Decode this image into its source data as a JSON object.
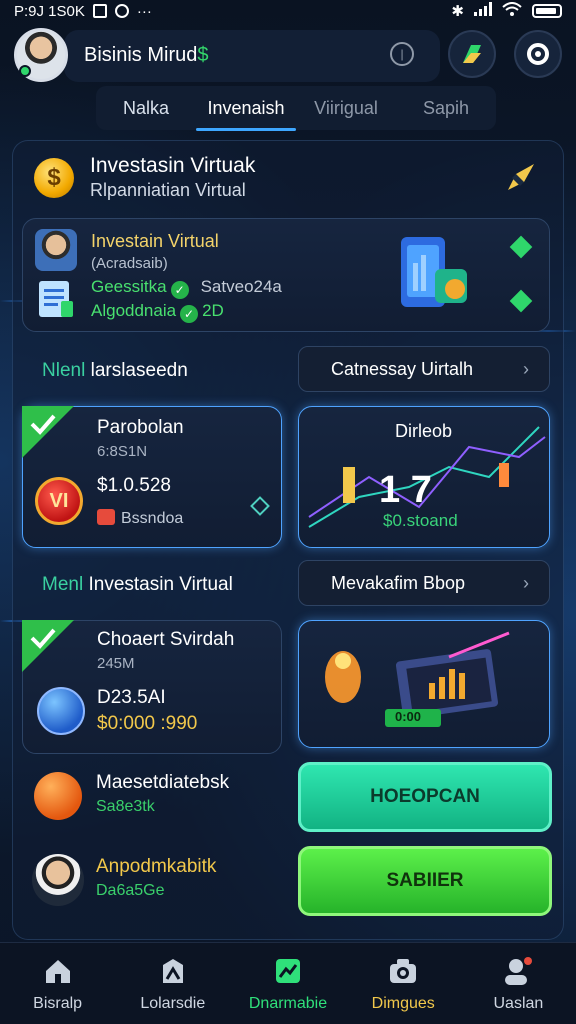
{
  "status": {
    "time": "P:9J 1S0K"
  },
  "header": {
    "title": "Bisinis Mirud",
    "title_accent": "$"
  },
  "tabs": [
    {
      "label": "Nalka"
    },
    {
      "label": "Invenaish"
    },
    {
      "label": "Viirigual"
    },
    {
      "label": "Sapih"
    }
  ],
  "intro": {
    "coin_symbol": "$",
    "title": "Investasin Virtuak",
    "subtitle": "Rlpanniatian Virtual"
  },
  "profile_card": {
    "title": "Investain Virtual",
    "note": "(Acradsaib)",
    "row1_green": "Geessitka",
    "row1_gray": "Satveo24a",
    "row2_green": "Algoddnaia",
    "row2_value": "2D"
  },
  "section1": {
    "label_green": "Nlenl",
    "label_white": "larslaseedn",
    "button": "Catnessay Uirtalh"
  },
  "card_parobolan": {
    "title": "Parobolan",
    "sub": "6:8S1N",
    "badge_text": "VI",
    "value": "$1.0.528",
    "small": "Bssndoa"
  },
  "card_chart": {
    "title": "Dirleob",
    "number": "1 7",
    "value": "$0.stoand"
  },
  "section2": {
    "label_green": "Menl",
    "label_white": "Investasin Virtual",
    "button": "Mevakafim Bbop"
  },
  "card_choaert": {
    "title": "Choaert Svirdah",
    "sub": "245M",
    "value": "D23.5AI",
    "gold_value": "$0:000 :990"
  },
  "card_laptop": {
    "tag": "0:00"
  },
  "list": [
    {
      "name": "Maesetdiatebsk",
      "meta": "Sa8e3tk"
    },
    {
      "name": "Anpodmkabitk",
      "meta": "Da6a5Ge"
    }
  ],
  "cta": {
    "teal": "HOEOPCAN",
    "green": "SABIIER"
  },
  "nav": [
    {
      "label": "Bisralp",
      "icon": "home-icon"
    },
    {
      "label": "Lolarsdie",
      "icon": "portfolio-icon"
    },
    {
      "label": "Dnarmabie",
      "icon": "market-icon",
      "active": true
    },
    {
      "label": "Dimgues",
      "icon": "camera-icon"
    },
    {
      "label": "Uaslan",
      "icon": "profile-icon"
    }
  ],
  "colors": {
    "accent_blue": "#3ea7ff",
    "accent_green": "#2fe07a",
    "gold": "#f2c84b"
  }
}
